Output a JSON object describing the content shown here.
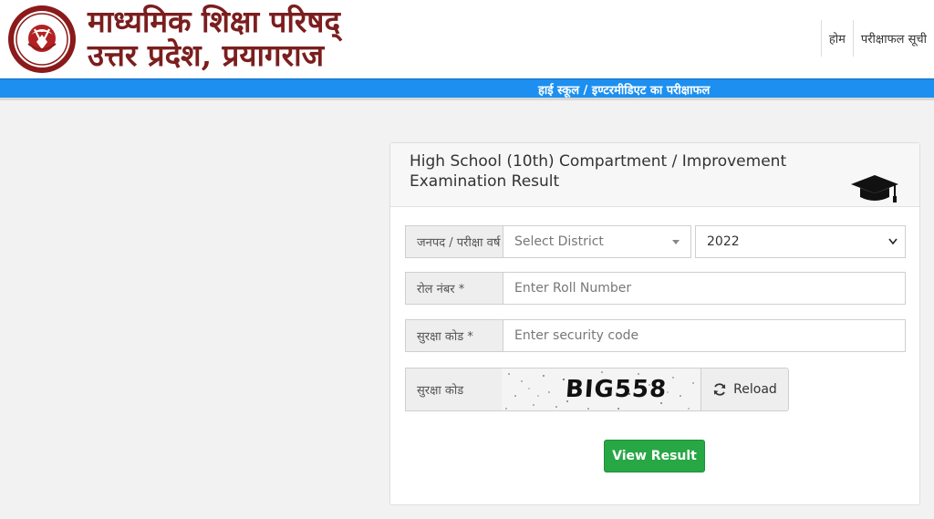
{
  "header": {
    "org_name_line1": "माध्यमिक शिक्षा परिषद्",
    "org_name_line2": "उत्तर प्रदेश, प्रयागराज",
    "logo_icon": "up-board-emblem-icon",
    "nav": [
      {
        "label": "होम"
      },
      {
        "label": "परीक्षाफल सूची"
      }
    ]
  },
  "banner": {
    "text": "हाई स्कूल / इण्टरमीडिएट का परीक्षाफल",
    "color": "#1c8ff0"
  },
  "form": {
    "title": "High School (10th) Compartment / Improvement Examination Result",
    "title_icon": "graduation-cap-icon",
    "district": {
      "label": "जनपद / परीक्षा वर्ष",
      "placeholder": "Select District"
    },
    "year": {
      "value": "2022"
    },
    "roll": {
      "label": "रोल नंबर *",
      "placeholder": "Enter Roll Number"
    },
    "security_input": {
      "label": "सुरक्षा कोड *",
      "placeholder": "Enter security code"
    },
    "captcha": {
      "label": "सुरक्षा कोड",
      "text": "BIG558"
    },
    "reload_label": "Reload",
    "reload_icon": "refresh-icon",
    "submit_label": "View Result",
    "submit_color": "#28a745"
  }
}
